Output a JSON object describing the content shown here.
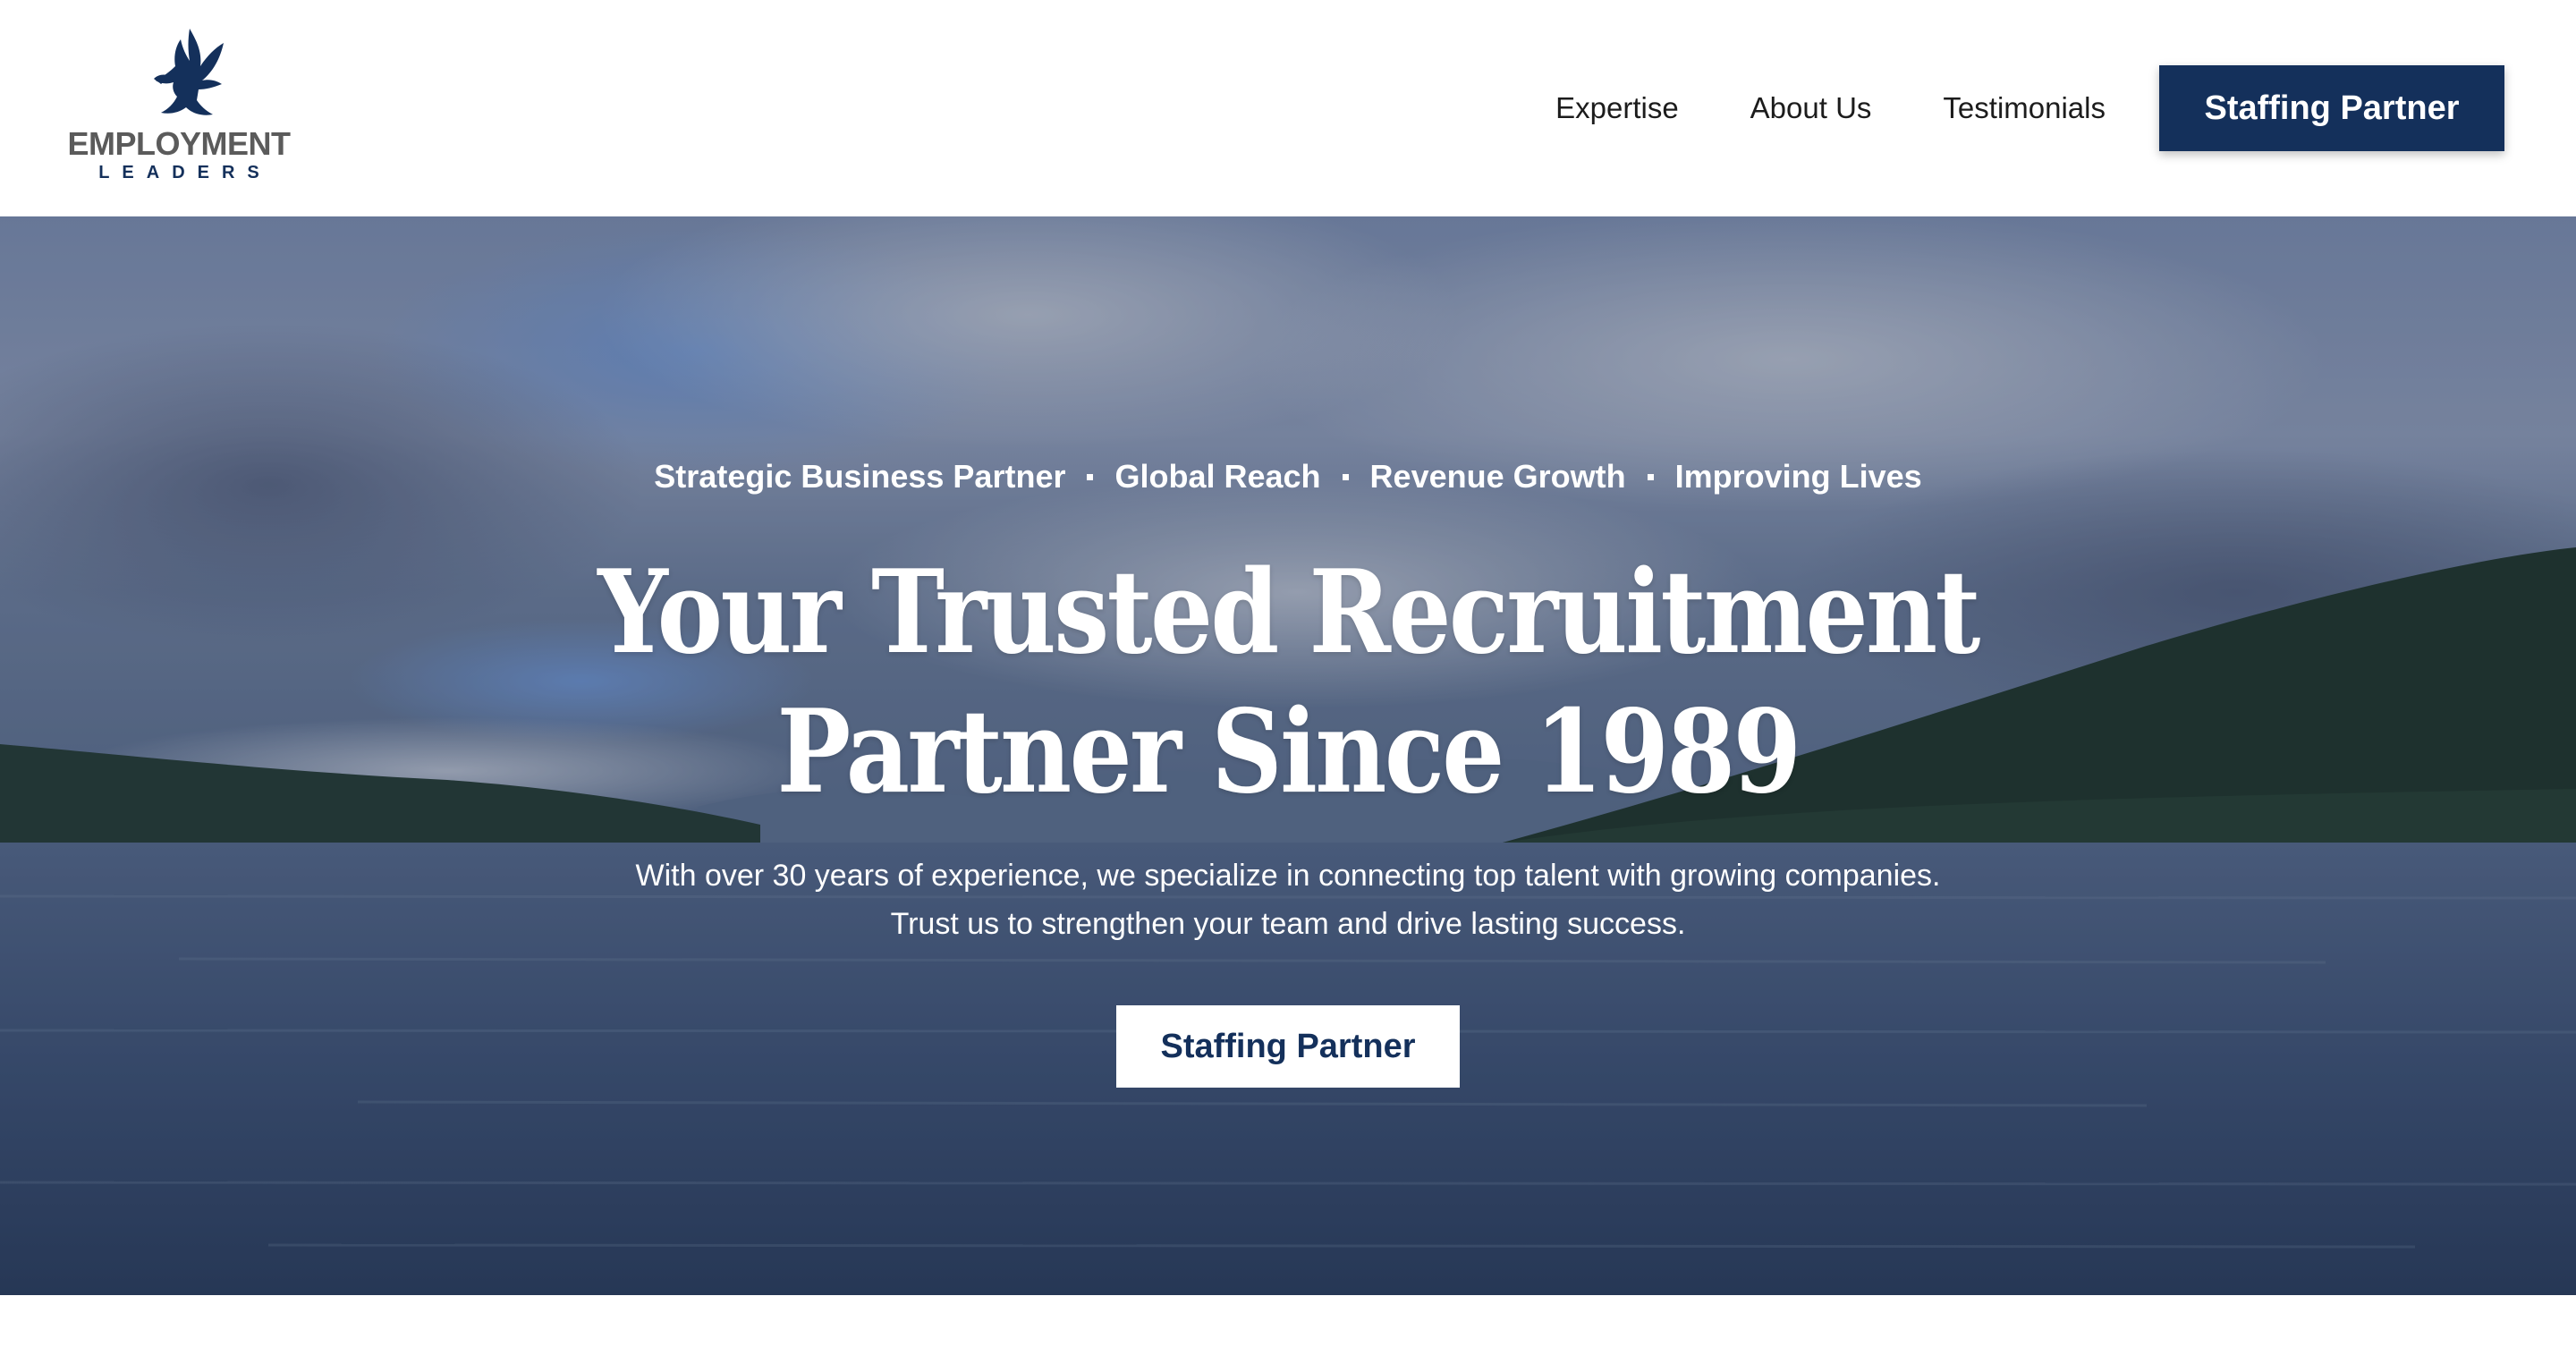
{
  "brand": {
    "name_line1": "EMPLOYMENT",
    "name_line2": "LEADERS",
    "logo_icon": "eagle-icon",
    "color_primary": "#14305b",
    "color_wordmark": "#5b5b5b"
  },
  "nav": {
    "links": [
      "Expertise",
      "About Us",
      "Testimonials"
    ],
    "cta_label": "Staffing Partner"
  },
  "hero": {
    "tagline": [
      "Strategic Business Partner",
      "Global Reach",
      "Revenue Growth",
      "Improving Lives"
    ],
    "headline_line1": "Your Trusted Recruitment",
    "headline_line2": "Partner Since 1989",
    "subtext_line1": "With over 30 years of experience, we specialize in connecting top talent with growing companies.",
    "subtext_line2": "Trust us to strengthen your team and drive lasting success.",
    "cta_label": "Staffing Partner",
    "background": "lake-with-forested-hills-under-cloudy-sky"
  }
}
